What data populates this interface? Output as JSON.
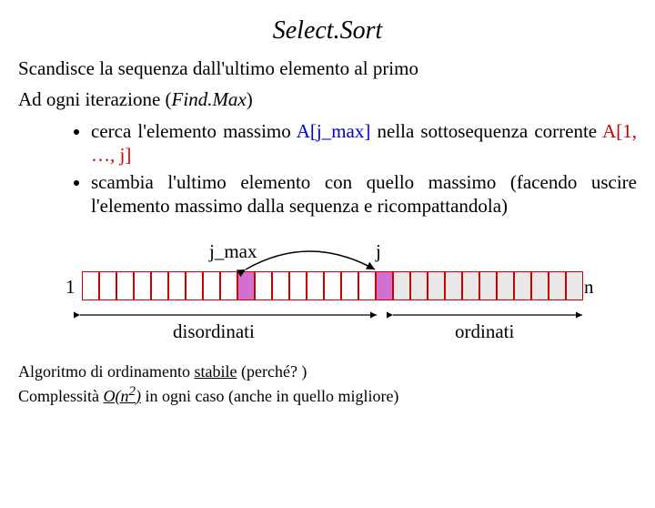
{
  "title": "Select.Sort",
  "p1": "Scandisce la sequenza dall'ultimo elemento al primo",
  "p2_a": "Ad ogni iterazione (",
  "p2_fm": "Find.Max",
  "p2_b": ")",
  "b1_a": "cerca l'elemento massimo ",
  "b1_blue": "A[j_max]",
  "b1_b": " nella sottosequenza corrente ",
  "b1_red": "A[1, …, j]",
  "b2": "scambia l'ultimo elemento con quello massimo (facendo uscire l'elemento massimo dalla sequenza e ricompattandola)",
  "lbl_jmax": "j_max",
  "lbl_j": "j",
  "lbl_1": "1",
  "lbl_n": "n",
  "lbl_dis": "disordinati",
  "lbl_ord": "ordinati",
  "f1_a": "Algoritmo di ordinamento ",
  "f1_b": "stabile",
  "f1_c": " (perché? )",
  "f2_a": "Complessità ",
  "f2_b": "O(n",
  "f2_exp": "2",
  "f2_c": ")",
  "f2_d": " in ogni caso (anche in quello migliore)"
}
